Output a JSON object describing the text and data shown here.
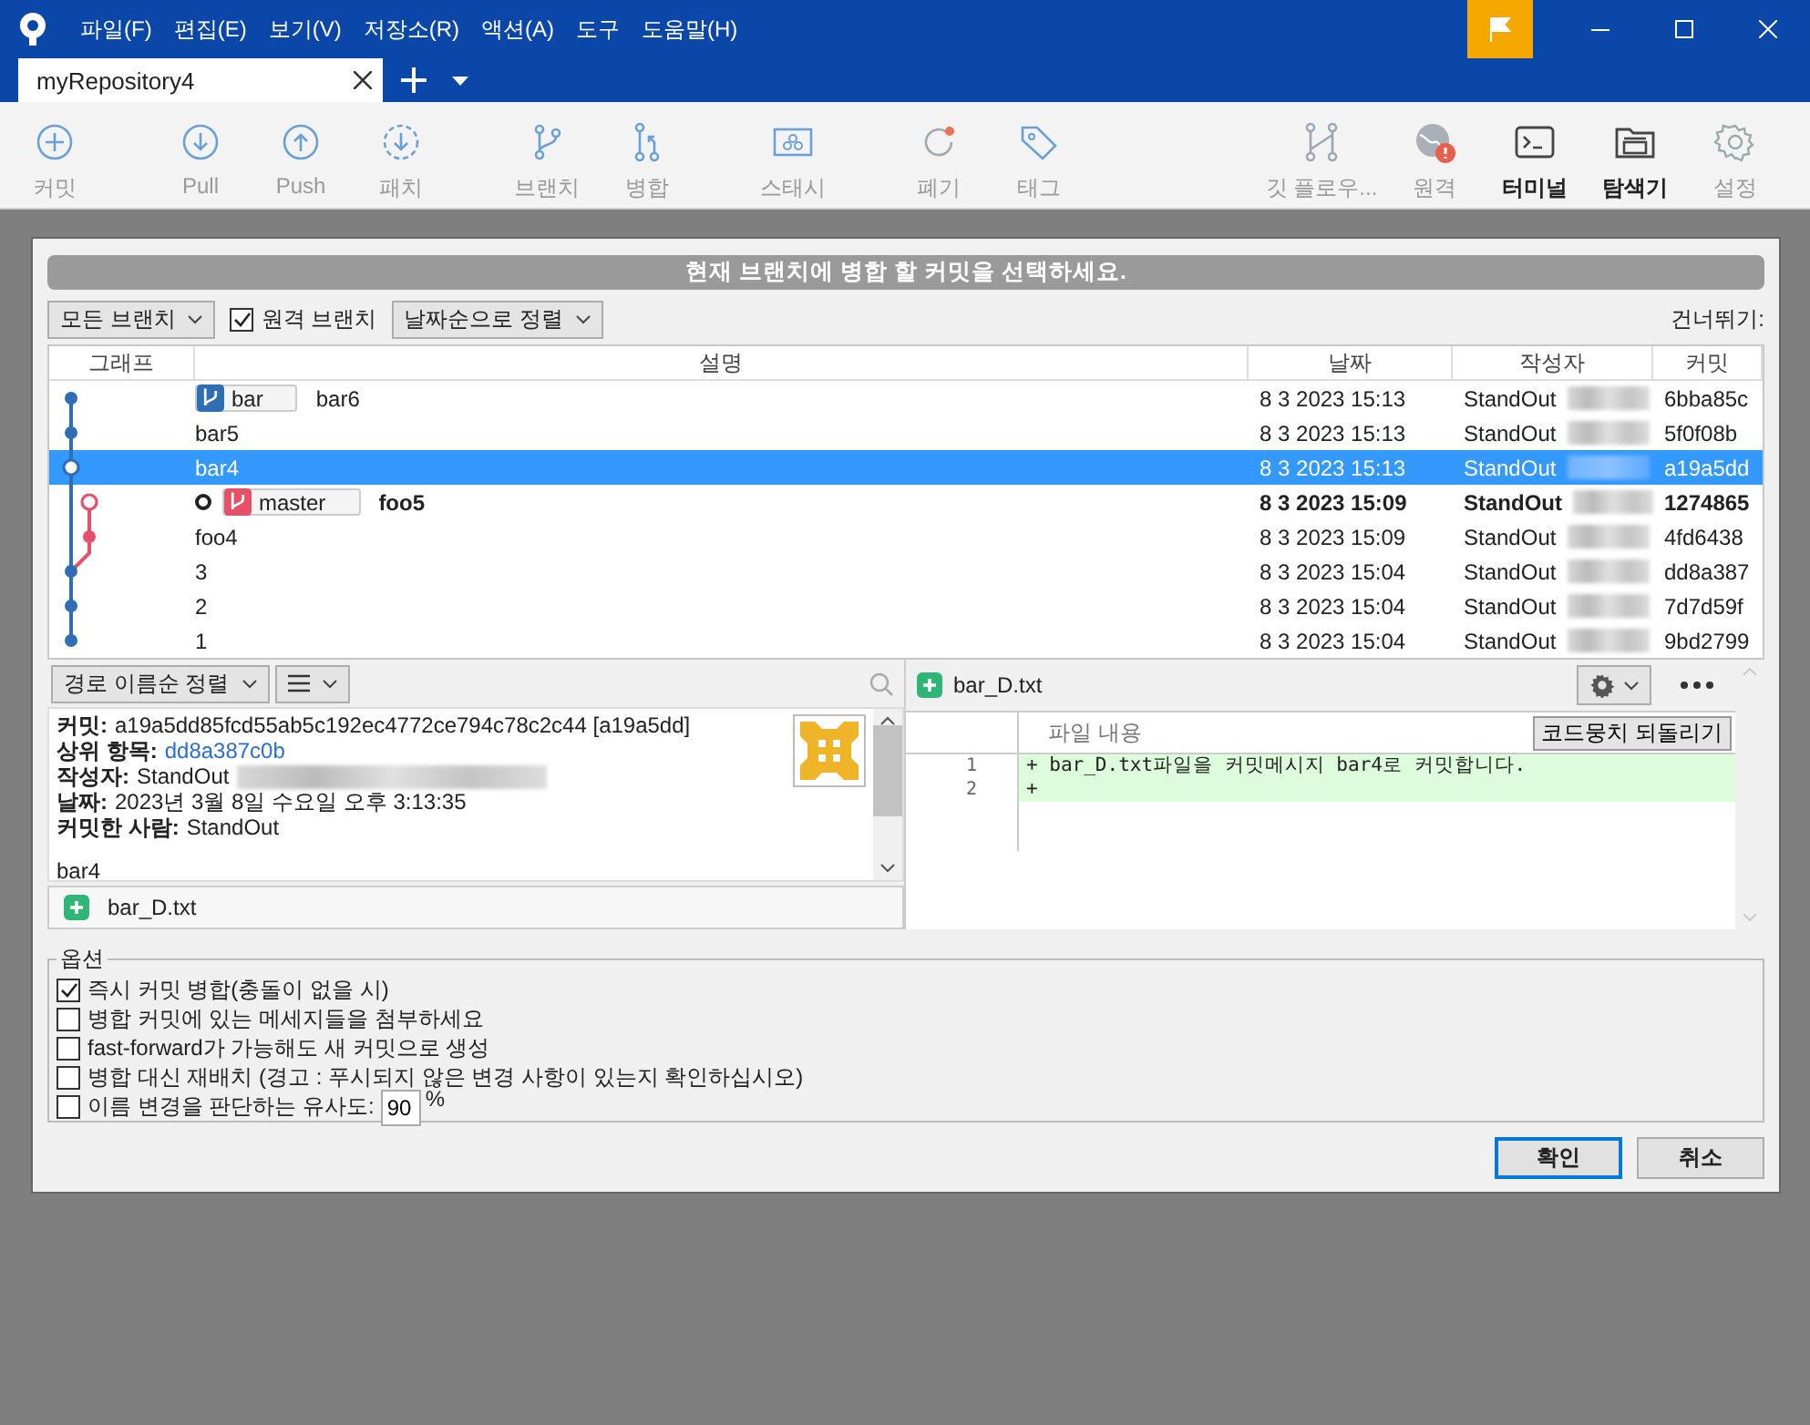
{
  "window": {
    "menu": [
      "파일(F)",
      "편집(E)",
      "보기(V)",
      "저장소(R)",
      "액션(A)",
      "도구",
      "도움말(H)"
    ]
  },
  "tabs": [
    {
      "label": "myRepository4",
      "selected": true
    }
  ],
  "toolbar": [
    {
      "label": "커밋",
      "disabled": true
    },
    {
      "label": "Pull",
      "disabled": true
    },
    {
      "label": "Push",
      "disabled": true
    },
    {
      "label": "패치",
      "disabled": true
    },
    {
      "label": "브랜치",
      "disabled": true
    },
    {
      "label": "병합",
      "disabled": true
    },
    {
      "label": "스태시",
      "disabled": true
    },
    {
      "label": "폐기",
      "disabled": true
    },
    {
      "label": "태그",
      "disabled": true
    },
    {
      "label": "깃 플로우...",
      "disabled": true
    },
    {
      "label": "원격",
      "disabled": true
    },
    {
      "label": "터미널",
      "disabled": false
    },
    {
      "label": "탐색기",
      "disabled": false
    },
    {
      "label": "설정",
      "disabled": true
    }
  ],
  "dialog": {
    "title": "현재 브랜치에 병합 할 커밋을 선택하세요.",
    "branch_filter": "모든 브랜치",
    "remote_branches": {
      "label": "원격 브랜치",
      "checked": true
    },
    "sort": "날짜순으로 정렬",
    "jump_label": "건너뛰기:",
    "table": {
      "columns": [
        "그래프",
        "설명",
        "날짜",
        "작성자",
        "커밋"
      ],
      "rows": [
        {
          "side_lane": false,
          "refs": [
            {
              "name": "bar",
              "color": "#2f6db5"
            }
          ],
          "current": false,
          "description": "bar6",
          "date": "8 3 2023 15:13",
          "author": "StandOut",
          "commit": "6bba85c",
          "selected": false
        },
        {
          "side_lane": false,
          "refs": [],
          "current": false,
          "description": "bar5",
          "date": "8 3 2023 15:13",
          "author": "StandOut",
          "commit": "5f0f08b",
          "selected": false
        },
        {
          "side_lane": false,
          "refs": [],
          "current": false,
          "description": "bar4",
          "date": "8 3 2023 15:13",
          "author": "StandOut",
          "commit": "a19a5dd",
          "selected": true
        },
        {
          "side_lane": true,
          "refs": [
            {
              "name": "master",
              "color": "#e8506a"
            }
          ],
          "current": true,
          "description": "foo5",
          "date": "8 3 2023 15:09",
          "author": "StandOut",
          "commit": "1274865",
          "selected": false
        },
        {
          "side_lane": true,
          "refs": [],
          "current": false,
          "description": "foo4",
          "date": "8 3 2023 15:09",
          "author": "StandOut",
          "commit": "4fd6438",
          "selected": false
        },
        {
          "side_lane": false,
          "refs": [],
          "current": false,
          "description": "3",
          "date": "8 3 2023 15:04",
          "author": "StandOut",
          "commit": "dd8a387",
          "selected": false
        },
        {
          "side_lane": false,
          "refs": [],
          "current": false,
          "description": "2",
          "date": "8 3 2023 15:04",
          "author": "StandOut",
          "commit": "7d7d59f",
          "selected": false
        },
        {
          "side_lane": false,
          "refs": [],
          "current": false,
          "description": "1",
          "date": "8 3 2023 15:04",
          "author": "StandOut",
          "commit": "9bd2799",
          "selected": false
        }
      ]
    },
    "details": {
      "file_sort": "경로 이름순 정렬",
      "fields": [
        {
          "label": "커밋:",
          "value": "a19a5dd85fcd55ab5c192ec4772ce794c78c2c44 [a19a5dd]",
          "kind": "text",
          "redacted": false
        },
        {
          "label": "상위 항목:",
          "value": "dd8a387c0b",
          "kind": "link",
          "redacted": false
        },
        {
          "label": "작성자:",
          "value": "StandOut",
          "kind": "text",
          "redacted": true
        },
        {
          "label": "날짜:",
          "value": "2023년 3월 8일 수요일 오후 3:13:35",
          "kind": "text",
          "redacted": false
        },
        {
          "label": "커밋한 사람:",
          "value": "StandOut",
          "kind": "text",
          "redacted": false
        }
      ],
      "message": "bar4",
      "files": [
        {
          "name": "bar_D.txt"
        }
      ]
    },
    "diff": {
      "file": "bar_D.txt",
      "header": "파일 내용",
      "revert_button": "코드뭉치 되돌리기",
      "lines": [
        {
          "number": "1",
          "text": "+ bar_D.txt파일을 커밋메시지 bar4로 커밋합니다."
        },
        {
          "number": "2",
          "text": "+"
        }
      ]
    },
    "options": {
      "title": "옵션",
      "items": [
        {
          "kind": "checkbox",
          "label": "즉시 커밋 병합(충돌이 없을 시)",
          "checked": true
        },
        {
          "kind": "checkbox",
          "label": "병합 커밋에 있는 메세지들을 첨부하세요",
          "checked": false
        },
        {
          "kind": "checkbox",
          "label": "fast-forward가 가능해도 새 커밋으로 생성",
          "checked": false
        },
        {
          "kind": "checkbox",
          "label": "병합 대신 재배치 (경고 : 푸시되지 않은 변경 사항이 있는지 확인하십시오)",
          "checked": false
        },
        {
          "kind": "similarity",
          "label": "이름 변경을 판단하는 유사도:",
          "checked": false,
          "value": "90",
          "unit": "%"
        }
      ]
    },
    "buttons": [
      {
        "label": "확인",
        "default": true
      },
      {
        "label": "취소",
        "default": false
      }
    ]
  }
}
